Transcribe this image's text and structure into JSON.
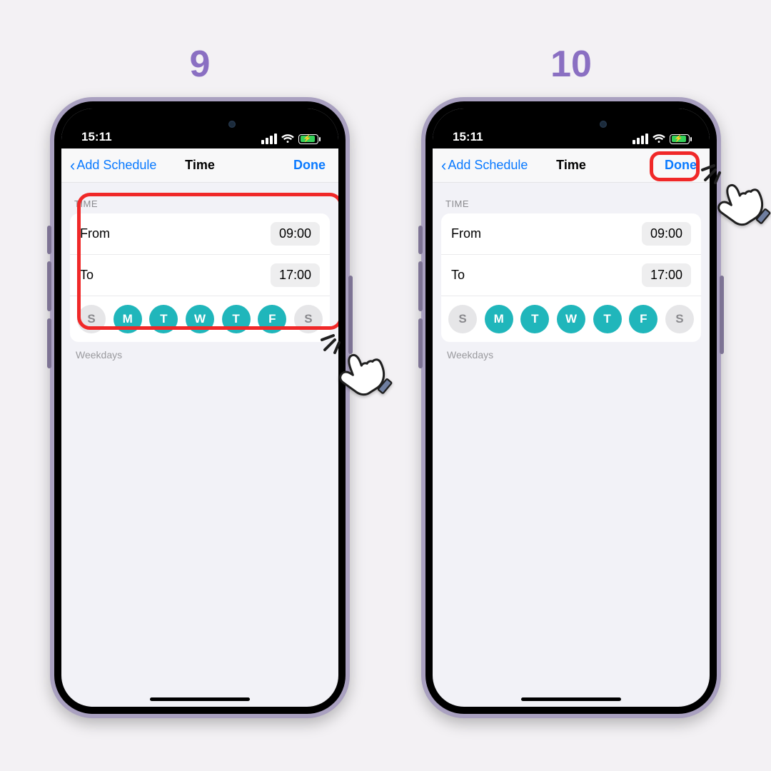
{
  "steps": [
    {
      "number": "9"
    },
    {
      "number": "10"
    }
  ],
  "status": {
    "time": "15:11"
  },
  "nav": {
    "back_label": "Add Schedule",
    "title": "Time",
    "done_label": "Done"
  },
  "time_section": {
    "header": "TIME",
    "from_label": "From",
    "from_value": "09:00",
    "to_label": "To",
    "to_value": "17:00",
    "days": [
      {
        "letter": "S",
        "selected": false
      },
      {
        "letter": "M",
        "selected": true
      },
      {
        "letter": "T",
        "selected": true
      },
      {
        "letter": "W",
        "selected": true
      },
      {
        "letter": "T",
        "selected": true
      },
      {
        "letter": "F",
        "selected": true
      },
      {
        "letter": "S",
        "selected": false
      }
    ],
    "footer": "Weekdays"
  }
}
